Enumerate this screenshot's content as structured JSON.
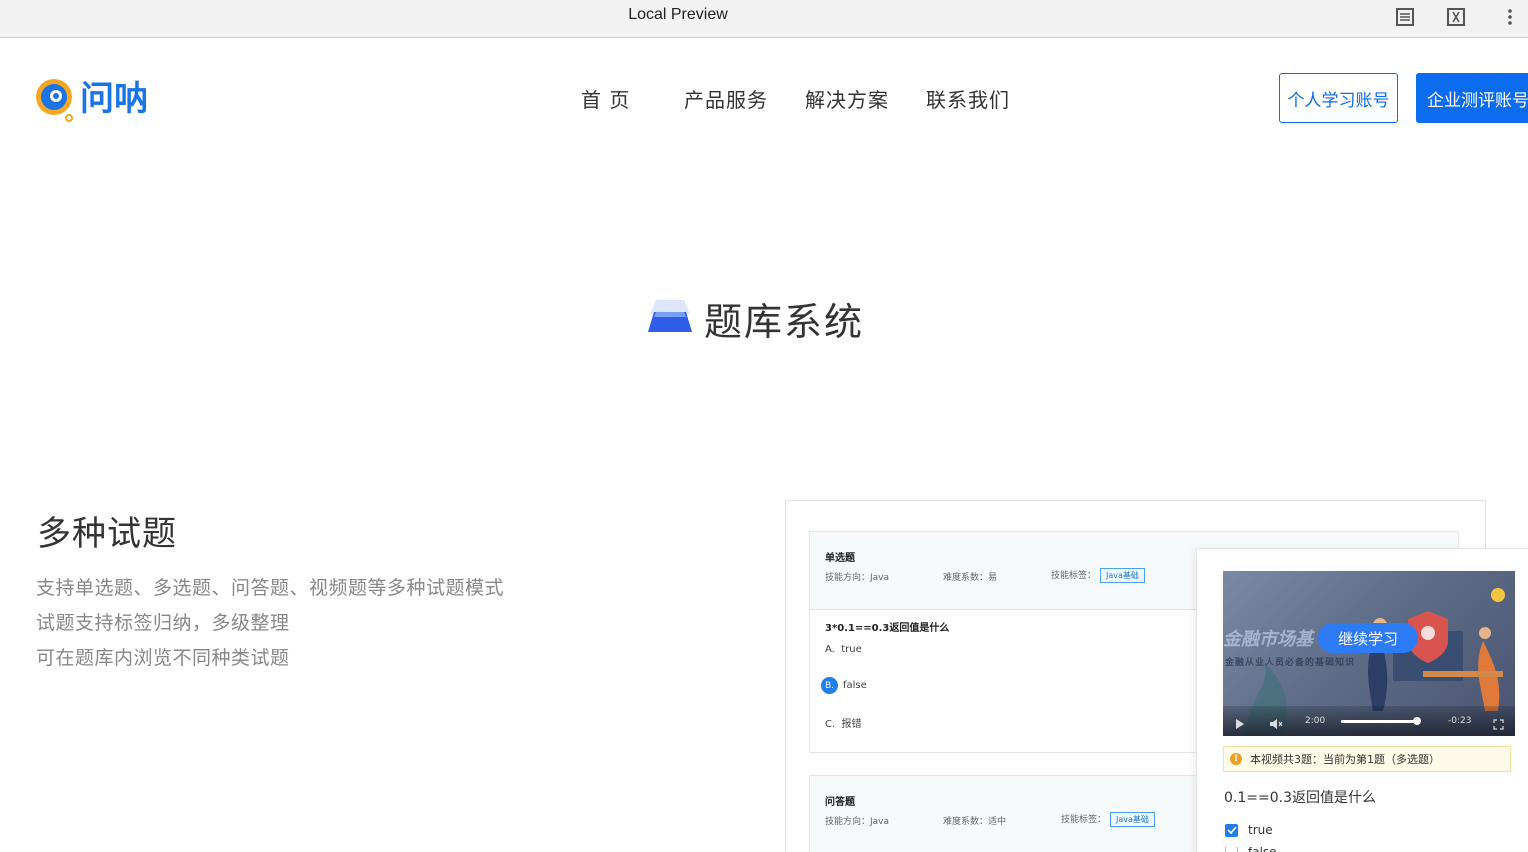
{
  "browser": {
    "title": "Local Preview",
    "icons": [
      "reader-mode-icon",
      "clear-format-icon",
      "more-vert-icon"
    ]
  },
  "header": {
    "logo_text": "问呐",
    "nav": [
      "首 页",
      "产品服务",
      "解决方案",
      "联系我们"
    ],
    "btn_personal": "个人学习账号",
    "btn_enterprise": "企业测评账号"
  },
  "section": {
    "title": "题库系统"
  },
  "feature": {
    "title": "多种试题",
    "lines": [
      "支持单选题、多选题、问答题、视频题等多种试题模式",
      "试题支持标签归纳，多级整理",
      "可在题库内浏览不同种类试题"
    ]
  },
  "mock": {
    "card1": {
      "type": "单选题",
      "direction": "技能方向：Java",
      "difficulty": "难度系数：易",
      "tag_label": "技能标签：",
      "tag": "Java基础",
      "question": "3*0.1==0.3返回值是什么",
      "options": [
        {
          "letter": "A.",
          "text": "true",
          "selected": false
        },
        {
          "letter": "B.",
          "text": "false",
          "selected": true
        },
        {
          "letter": "C.",
          "text": "报错",
          "selected": false
        }
      ]
    },
    "card2": {
      "type": "问答题",
      "direction": "技能方向：Java",
      "difficulty": "难度系数：适中",
      "tag_label": "技能标签：",
      "tag": "Java基础"
    },
    "video": {
      "bg_text": "金融市场基",
      "bg_subtext": "金融从业人员必备的基础知识",
      "continue": "继续学习",
      "time_current": "2:00",
      "time_remaining": "-0:23",
      "progress": 0.84,
      "notice": "本视频共3题：当前为第1题（多选题）",
      "question": "0.1==0.3返回值是什么",
      "options": [
        {
          "text": "true",
          "checked": true
        },
        {
          "text": "false",
          "checked": false
        }
      ]
    }
  },
  "colors": {
    "brand_blue": "#0b6cf0",
    "logo_orange": "#f5a623"
  }
}
